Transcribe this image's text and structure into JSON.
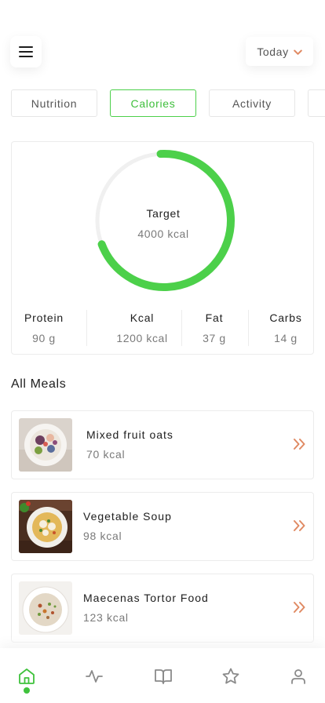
{
  "header": {
    "menu_icon": "hamburger-menu-icon",
    "date_filter": {
      "label": "Today",
      "icon": "chevron-down-icon"
    }
  },
  "tabs": [
    {
      "label": "Nutrition",
      "active": false
    },
    {
      "label": "Calories",
      "active": true
    },
    {
      "label": "Activity",
      "active": false
    }
  ],
  "summary": {
    "target_label": "Target",
    "target_value": "4000 kcal",
    "progress": 0.7,
    "stats": [
      {
        "label": "Protein",
        "value": "90 g"
      },
      {
        "label": "Kcal",
        "value": "1200 kcal"
      },
      {
        "label": "Fat",
        "value": "37 g"
      },
      {
        "label": "Carbs",
        "value": "14 g"
      }
    ]
  },
  "meals_section": {
    "title": "All Meals",
    "items": [
      {
        "name": "Mixed fruit oats",
        "kcal": "70 kcal",
        "image": "fruit-oats-bowl-photo"
      },
      {
        "name": "Vegetable Soup",
        "kcal": "98 kcal",
        "image": "vegetable-soup-bowl-photo"
      },
      {
        "name": "Maecenas Tortor Food",
        "kcal": "123 kcal",
        "image": "porridge-bowl-photo"
      }
    ]
  },
  "bottom_nav": [
    {
      "icon": "home-icon",
      "active": true
    },
    {
      "icon": "activity-pulse-icon",
      "active": false
    },
    {
      "icon": "open-book-icon",
      "active": false
    },
    {
      "icon": "star-icon",
      "active": false
    },
    {
      "icon": "user-profile-icon",
      "active": false
    }
  ],
  "colors": {
    "accent_green": "#4cd04a",
    "arrow_orange": "#e08a63",
    "text_dark": "#1d1d1d",
    "text_muted": "#7a7a7a",
    "border": "#ececec"
  }
}
